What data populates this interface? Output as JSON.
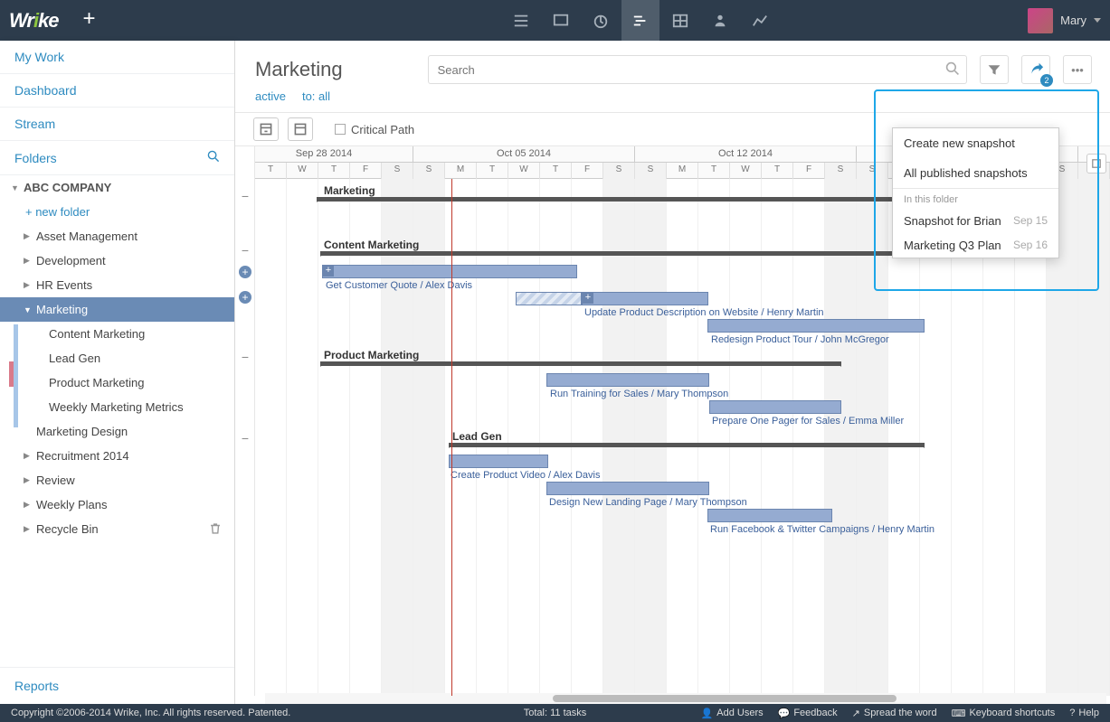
{
  "brand": "Wrike",
  "user": {
    "name": "Mary"
  },
  "sidebar": {
    "nav": [
      "My Work",
      "Dashboard",
      "Stream"
    ],
    "folders_label": "Folders",
    "company": "ABC COMPANY",
    "new_folder": "+  new folder",
    "items": [
      "Asset Management",
      "Development",
      "HR Events",
      "Marketing",
      "Content Marketing",
      "Lead Gen",
      "Product Marketing",
      "Weekly Marketing Metrics",
      "Marketing Design",
      "Recruitment 2014",
      "Review",
      "Weekly Plans",
      "Recycle Bin"
    ],
    "reports": "Reports"
  },
  "header": {
    "title": "Marketing",
    "search_placeholder": "Search",
    "share_badge": "2",
    "filters": {
      "active": "active",
      "to": "to: all"
    }
  },
  "toolbar": {
    "critical_path": "Critical Path"
  },
  "dropdown": {
    "create": "Create new snapshot",
    "all_pub": "All published snapshots",
    "in_folder": "In this folder",
    "snaps": [
      {
        "name": "Snapshot for Brian",
        "date": "Sep 15"
      },
      {
        "name": "Marketing Q3 Plan",
        "date": "Sep 16"
      }
    ]
  },
  "timeline": {
    "weeks": [
      "Sep 28 2014",
      "Oct 05 2014",
      "Oct 12 2014"
    ],
    "days": [
      "T",
      "W",
      "T",
      "F",
      "S",
      "S",
      "M",
      "T",
      "W",
      "T",
      "F",
      "S",
      "S",
      "M",
      "T",
      "W",
      "T",
      "F",
      "S",
      "S",
      "M",
      "T",
      "W",
      "T",
      "F",
      "S",
      "S"
    ],
    "groups": {
      "g1": "Marketing",
      "g2": "Content Marketing",
      "g3": "Product Marketing",
      "g4": "Lead Gen"
    },
    "tasks": {
      "t1": "Get Customer Quote / Alex Davis",
      "t2": "Update Product Description on Website / Henry Martin",
      "t3": "Redesign Product Tour / John McGregor",
      "t4": "Run Training for Sales / Mary Thompson",
      "t5": "Prepare One Pager for Sales / Emma Miller",
      "t6": "Create Product Video / Alex Davis",
      "t7": "Design New Landing Page / Mary Thompson",
      "t8": "Run Facebook & Twitter Campaigns / Henry Martin"
    }
  },
  "footer": {
    "copyright": "Copyright ©2006-2014 Wrike, Inc. All rights reserved. Patented.",
    "total": "Total: 11 tasks",
    "links": [
      "Add Users",
      "Feedback",
      "Spread the word",
      "Keyboard shortcuts",
      "Help"
    ]
  }
}
